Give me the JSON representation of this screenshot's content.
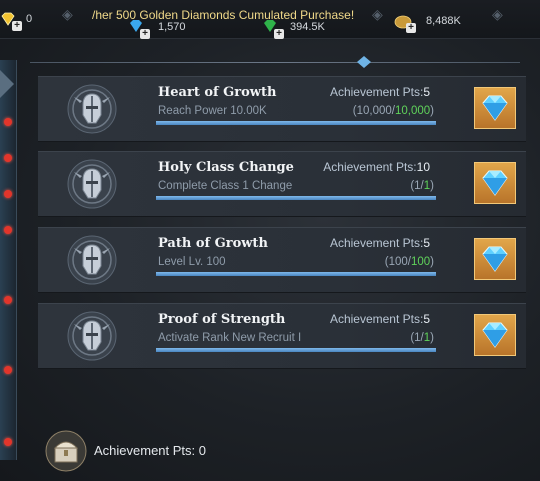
{
  "top_bar": {
    "currencies": [
      {
        "icon": "gold-diamond-icon",
        "value": "0"
      },
      {
        "icon": "blue-diamond-icon",
        "value": "1,570"
      },
      {
        "icon": "green-gem-icon",
        "value": "394.5K"
      },
      {
        "icon": "gold-coin-icon",
        "value": "8,488K"
      }
    ],
    "marquee": "/her 500 Golden Diamonds Cumulated Purchase!"
  },
  "achievements": [
    {
      "title": "Heart of Growth",
      "pts_label": "Achievement Pts:",
      "pts": "5",
      "requirement": "Reach Power 10.00K",
      "progress_open": "(10,000/",
      "progress_done": "10,000",
      "progress_close": ")",
      "progress_fraction": 1.0,
      "reward_icon": "blue-diamond-icon"
    },
    {
      "title": "Holy Class Change",
      "pts_label": "Achievement Pts:",
      "pts": "10",
      "requirement": "Complete Class 1 Change",
      "progress_open": "(1/",
      "progress_done": "1",
      "progress_close": ")",
      "progress_fraction": 1.0,
      "reward_icon": "blue-diamond-icon"
    },
    {
      "title": "Path of Growth",
      "pts_label": "Achievement Pts:",
      "pts": "5",
      "requirement": "Level Lv. 100",
      "progress_open": "(100/",
      "progress_done": "100",
      "progress_close": ")",
      "progress_fraction": 1.0,
      "reward_icon": "blue-diamond-icon"
    },
    {
      "title": "Proof of Strength",
      "pts_label": "Achievement Pts:",
      "pts": "5",
      "requirement": "Activate Rank New Recruit I",
      "progress_open": "(1/",
      "progress_done": "1",
      "progress_close": ")",
      "progress_fraction": 1.0,
      "reward_icon": "blue-diamond-icon"
    }
  ],
  "footer": {
    "label": "Achievement Pts: 0",
    "icon": "treasure-chest-icon"
  },
  "colors": {
    "progress_done": "#5fd35a",
    "reward_bg": "#d0913c",
    "notification": "#e2352b"
  }
}
